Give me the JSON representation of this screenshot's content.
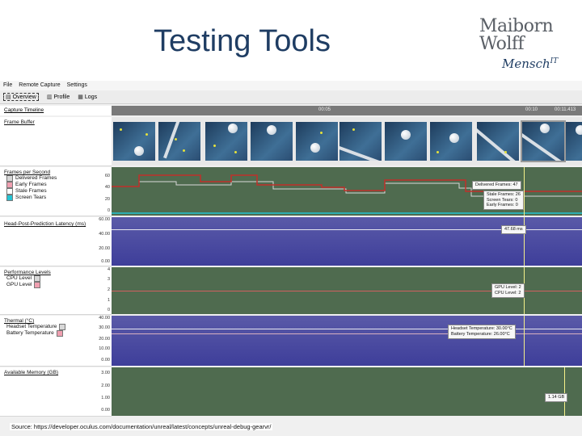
{
  "slide": {
    "title": "Testing Tools",
    "logo_line1": "Maiborn",
    "logo_line2": "Wolff",
    "logo_signature": "Mensch",
    "logo_signature_sup": "IT",
    "source": "Source: https://developer.oculus.com/documentation/unreal/latest/concepts/unreal-debug-gearvr/"
  },
  "menu": [
    "File",
    "Remote Capture",
    "Settings"
  ],
  "tabs": [
    {
      "label": "Overview",
      "icon": "overview-icon"
    },
    {
      "label": "Profile",
      "icon": "profile-icon"
    },
    {
      "label": "Logs",
      "icon": "logs-icon"
    }
  ],
  "timeline": {
    "label": "Capture Timeline",
    "ticks": [
      "00:05",
      "00:10",
      "00:11.413"
    ]
  },
  "frame_buffer": {
    "label": "Frame Buffer"
  },
  "fps": {
    "label": "Frames per Second",
    "legend": [
      {
        "name": "Delivered Frames",
        "color": "#d8d8d8"
      },
      {
        "name": "Early Frames",
        "color": "#ef9fb0"
      },
      {
        "name": "Stale Frames",
        "color": "#ffffff"
      },
      {
        "name": "Screen Tears",
        "color": "#24c4d4"
      }
    ],
    "axis": [
      "60",
      "40",
      "20",
      "0"
    ],
    "tooltip_main": "Delivered Frames: 47",
    "tooltip_sub": [
      "Stale Frames: 26",
      "Screen Tears: 0",
      "Early Frames: 0"
    ]
  },
  "latency": {
    "label": "Head-Post-Prediction Latency (ms)",
    "axis": [
      "60.00",
      "40.00",
      "20.00",
      "0.00"
    ],
    "tooltip": "47.68 ms"
  },
  "perf": {
    "label": "Performance Levels",
    "legend": [
      {
        "name": "CPU Level",
        "color": "#d8d8d8"
      },
      {
        "name": "GPU Level",
        "color": "#ef9fb0"
      }
    ],
    "axis": [
      "4",
      "3",
      "2",
      "1",
      "0"
    ],
    "tooltip": [
      "GPU Level: 2",
      "CPU Level: 2"
    ]
  },
  "thermal": {
    "label": "Thermal (°C)",
    "legend": [
      {
        "name": "Headset Temperature",
        "color": "#d8d8d8"
      },
      {
        "name": "Battery Temperature",
        "color": "#ef9fb0"
      }
    ],
    "axis": [
      "40.00",
      "30.00",
      "20.00",
      "10.00",
      "0.00"
    ],
    "tooltip": [
      "Headset Temperature: 30.00°C",
      "Battery Temperature: 26.00°C"
    ]
  },
  "memory": {
    "label": "Available Memory (GB)",
    "axis": [
      "3.00",
      "2.00",
      "1.00",
      "0.00"
    ],
    "tooltip": "1.14 GB"
  },
  "colors": {
    "fps_bg": "#4f6b4f",
    "latency_bg": "#4a4aa0",
    "cursor": "#f5f08a",
    "fps_line": "#c0302a"
  }
}
